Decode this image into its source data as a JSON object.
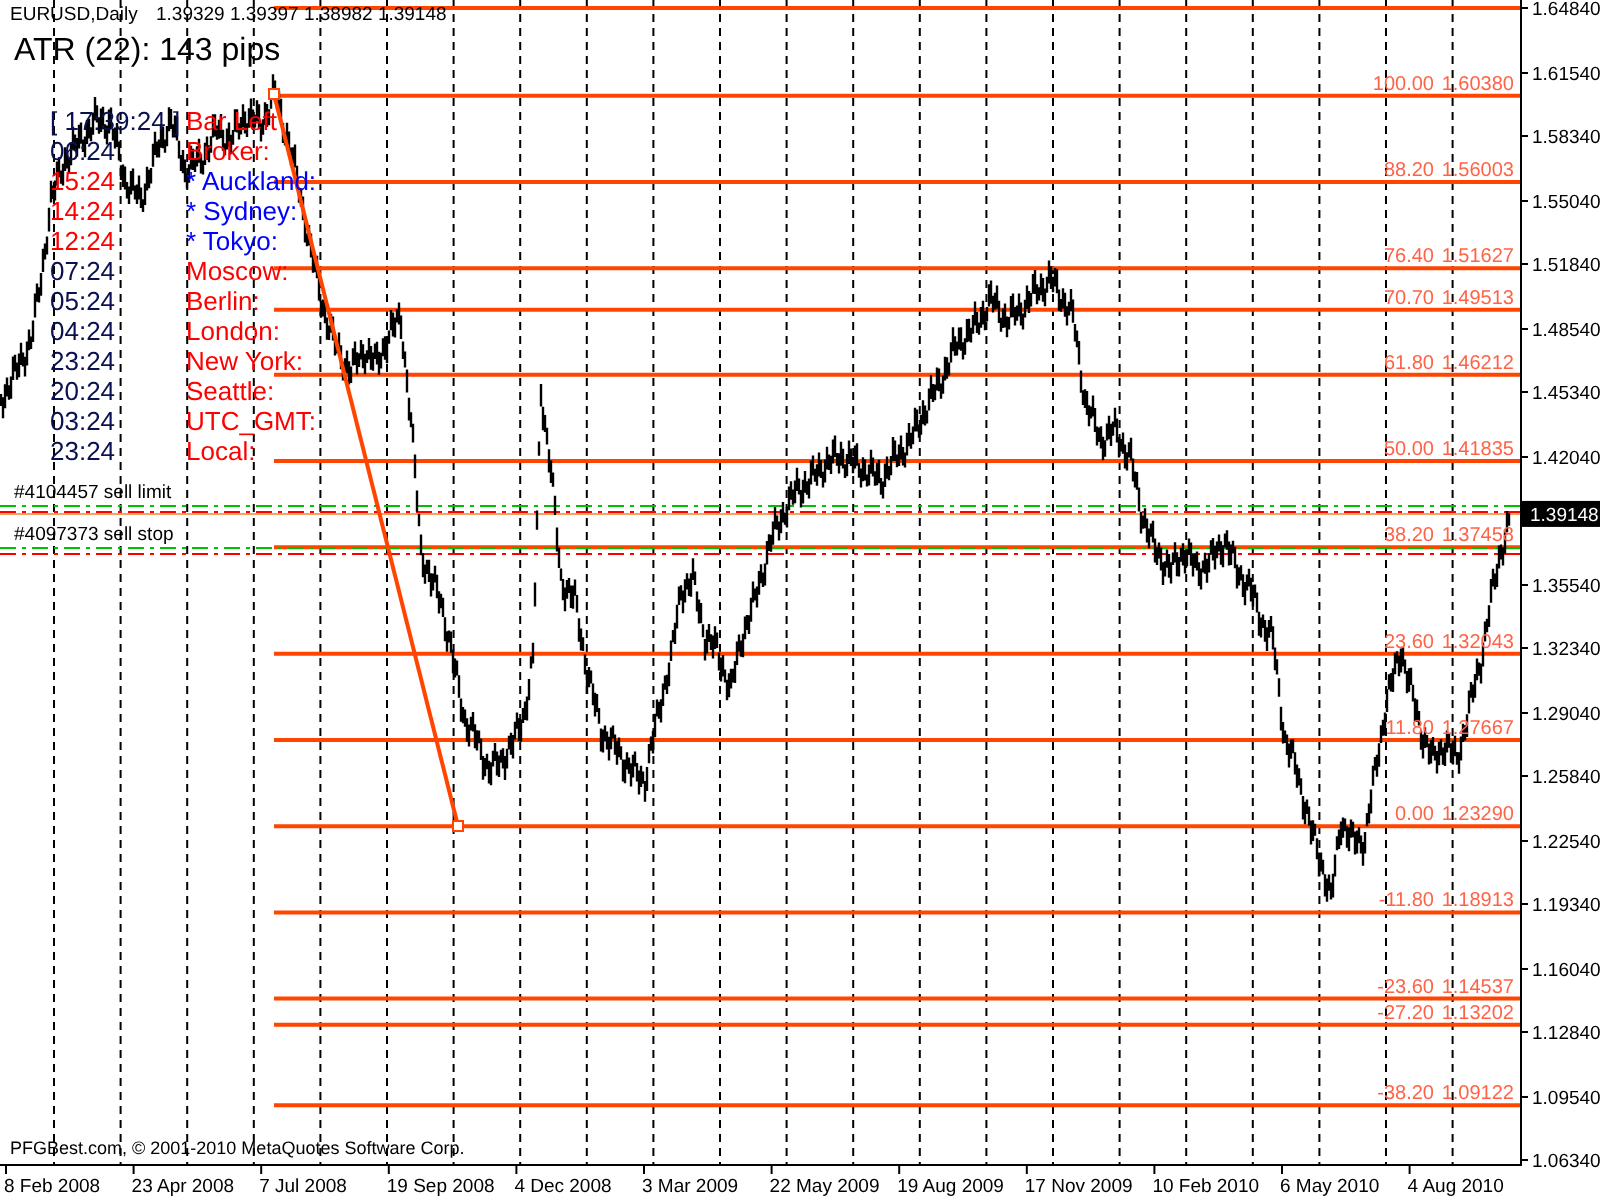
{
  "header": {
    "symbol": "EURUSD,Daily",
    "quotes": "1.39329 1.39397 1.38982 1.39148"
  },
  "indicator": {
    "text": "ATR (22): 143 pips"
  },
  "clock": {
    "time": "[ 17:39:24 ]",
    "label": "Bar Left",
    "rows": [
      {
        "kind": "broker",
        "time": "06:24",
        "label": "Broker:"
      },
      {
        "kind": "market",
        "time": "15:24",
        "label": "* Auckland:"
      },
      {
        "kind": "market",
        "time": "14:24",
        "label": "* Sydney:"
      },
      {
        "kind": "market",
        "time": "12:24",
        "label": "* Tokyo:"
      },
      {
        "kind": "city",
        "time": "07:24",
        "label": "Moscow:"
      },
      {
        "kind": "city",
        "time": "05:24",
        "label": "Berlin:"
      },
      {
        "kind": "city",
        "time": "04:24",
        "label": "London:"
      },
      {
        "kind": "city",
        "time": "23:24",
        "label": "New York:"
      },
      {
        "kind": "city",
        "time": "20:24",
        "label": "Seattle:"
      },
      {
        "kind": "city",
        "time": "03:24",
        "label": "UTC_GMT:"
      },
      {
        "kind": "city",
        "time": "23:24",
        "label": "Local:"
      }
    ]
  },
  "fibonacci": {
    "levels": [
      {
        "level": "100.00",
        "price": "1.60380"
      },
      {
        "level": "88.20",
        "price": "1.56003"
      },
      {
        "level": "76.40",
        "price": "1.51627"
      },
      {
        "level": "70.70",
        "price": "1.49513"
      },
      {
        "level": "61.80",
        "price": "1.46212"
      },
      {
        "level": "50.00",
        "price": "1.41835"
      },
      {
        "level": "38.20",
        "price": "1.37458"
      },
      {
        "level": "23.60",
        "price": "1.32043"
      },
      {
        "level": "11.80",
        "price": "1.27667"
      },
      {
        "level": "0.00",
        "price": "1.23290"
      },
      {
        "level": "-11.80",
        "price": "1.18913"
      },
      {
        "level": "-23.60",
        "price": "1.14537"
      },
      {
        "level": "-27.20",
        "price": "1.13202"
      },
      {
        "level": "-38.20",
        "price": "1.09122"
      }
    ]
  },
  "orders": [
    {
      "label": "#4104457 sell limit"
    },
    {
      "label": "#4097373 sell stop"
    }
  ],
  "price_axis": {
    "labels": [
      "1.64840",
      "1.61540",
      "1.58340",
      "1.55040",
      "1.51840",
      "1.48540",
      "1.45340",
      "1.42040",
      "1.35540",
      "1.32340",
      "1.29040",
      "1.25840",
      "1.22540",
      "1.19340",
      "1.16040",
      "1.12840",
      "1.09540",
      "1.06340"
    ],
    "current": "1.39148"
  },
  "time_axis": {
    "labels": [
      "8 Feb 2008",
      "23 Apr 2008",
      "7 Jul 2008",
      "19 Sep 2008",
      "4 Dec 2008",
      "3 Mar 2009",
      "22 May 2009",
      "19 Aug 2009",
      "17 Nov 2009",
      "10 Feb 2010",
      "6 May 2010",
      "4 Aug 2010"
    ]
  },
  "copyright": "PFGBest.com, © 2001-2010 MetaQuotes Software Corp."
}
